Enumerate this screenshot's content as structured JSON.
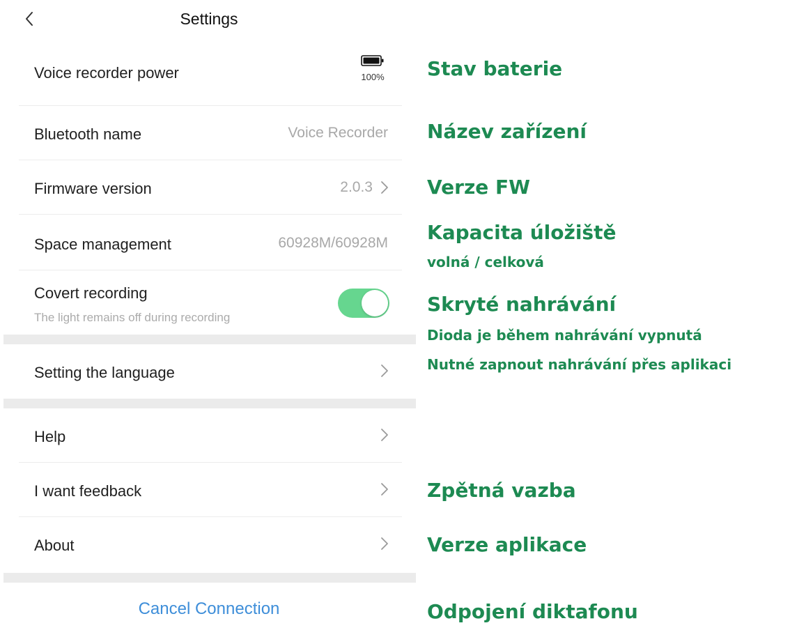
{
  "header": {
    "title": "Settings"
  },
  "rows": {
    "power": {
      "label": "Voice recorder power",
      "battery_percent": "100%"
    },
    "bluetooth": {
      "label": "Bluetooth name",
      "value": "Voice Recorder"
    },
    "firmware": {
      "label": "Firmware version",
      "value": "2.0.3"
    },
    "space": {
      "label": "Space management",
      "value": "60928M/60928M"
    },
    "covert": {
      "label": "Covert recording",
      "sublabel": "The light remains off during recording",
      "enabled": true
    },
    "language": {
      "label": "Setting the language"
    },
    "help": {
      "label": "Help"
    },
    "feedback": {
      "label": "I want feedback"
    },
    "about": {
      "label": "About"
    }
  },
  "cancel_label": "Cancel Connection",
  "colors": {
    "accent_green": "#66d68f",
    "link_blue": "#3e8ed9",
    "annotation_green": "#1d8a52"
  },
  "annotations": {
    "battery": "Stav baterie",
    "device_name": "Název zařízení",
    "fw": "Verze FW",
    "capacity": "Kapacita úložiště",
    "capacity_sub": "volná / celková",
    "covert": "Skryté nahrávání",
    "covert_sub1": "Dioda je během nahrávání vypnutá",
    "covert_sub2": "Nutné zapnout nahrávání přes aplikaci",
    "feedback": "Zpětná vazba",
    "app_version": "Verze aplikace",
    "disconnect": "Odpojení diktafonu"
  }
}
